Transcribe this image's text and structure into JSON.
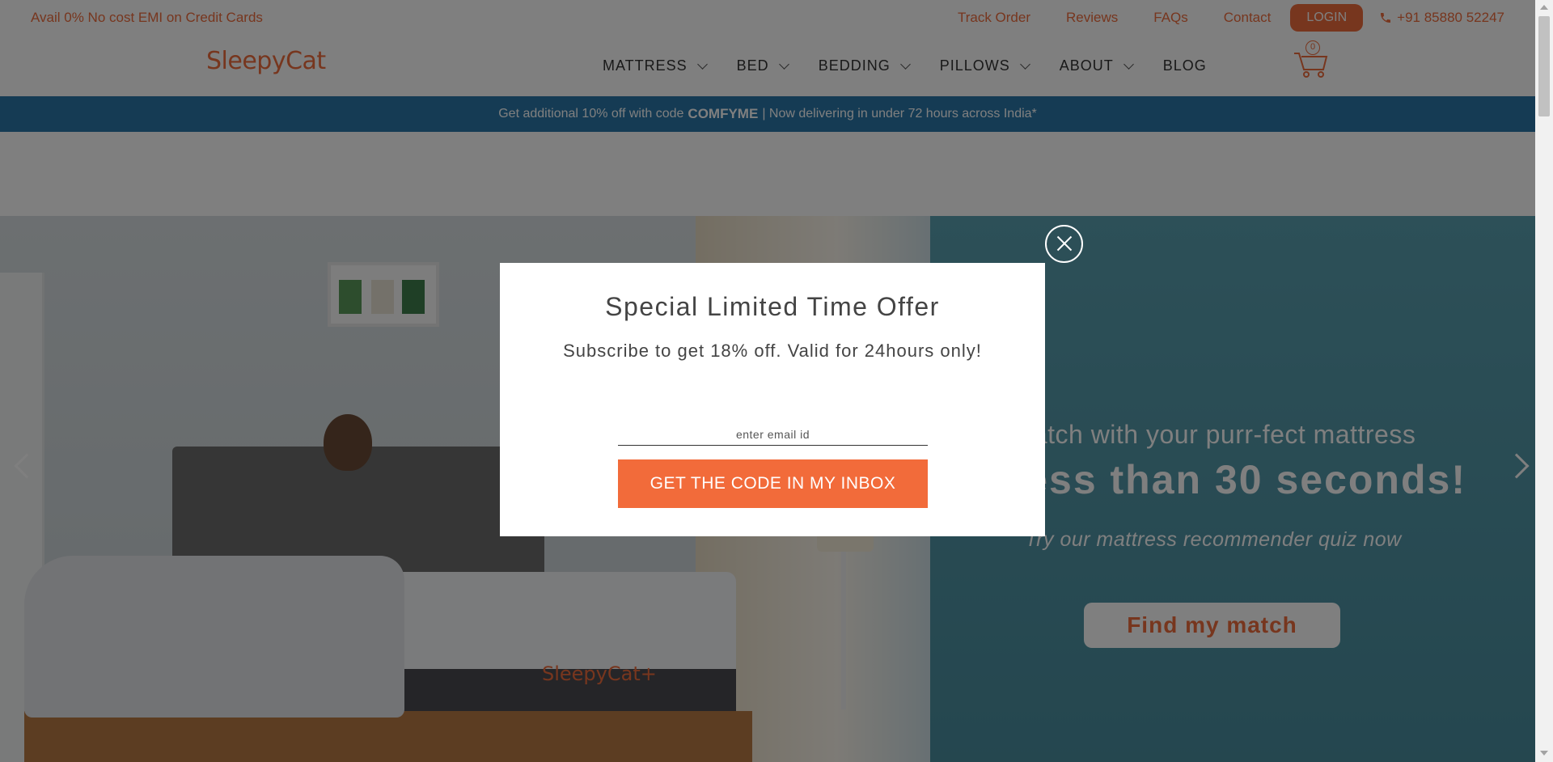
{
  "topbar": {
    "promo": "Avail 0% No cost EMI on Credit Cards",
    "links": [
      "Track Order",
      "Reviews",
      "FAQs",
      "Contact"
    ],
    "login": "LOGIN",
    "phone": "+91 85880 52247"
  },
  "brand": {
    "name": "SleepyCat",
    "mattress_brand": "SleepyCat+"
  },
  "nav": {
    "items": [
      {
        "label": "MATTRESS",
        "has_dropdown": true
      },
      {
        "label": "BED",
        "has_dropdown": true
      },
      {
        "label": "BEDDING",
        "has_dropdown": true
      },
      {
        "label": "PILLOWS",
        "has_dropdown": true
      },
      {
        "label": "ABOUT",
        "has_dropdown": true
      },
      {
        "label": "BLOG",
        "has_dropdown": false
      }
    ],
    "cart_count": "0"
  },
  "announce": {
    "prefix": "Get additional 10% off with code",
    "code": "COMFYME",
    "suffix": "| Now delivering in under 72 hours across India*"
  },
  "hero": {
    "line1": "Match with your purr-fect mattress",
    "line2": "in less than 30 seconds!",
    "line3": "Try our mattress recommender quiz now",
    "button": "Find my match"
  },
  "modal": {
    "title": "Special Limited Time Offer",
    "subtitle": "Subscribe to get 18% off. Valid for 24hours only!",
    "email_placeholder": "enter email id",
    "cta": "GET THE CODE IN MY INBOX"
  },
  "colors": {
    "accent": "#ef6c3d",
    "announce_bg": "#2a77a8",
    "hero_right": "#4a8e9f"
  },
  "icons": {
    "phone": "phone-icon",
    "cart": "cart-icon",
    "close": "close-icon",
    "prev": "chevron-left-icon",
    "next": "chevron-right-icon"
  }
}
